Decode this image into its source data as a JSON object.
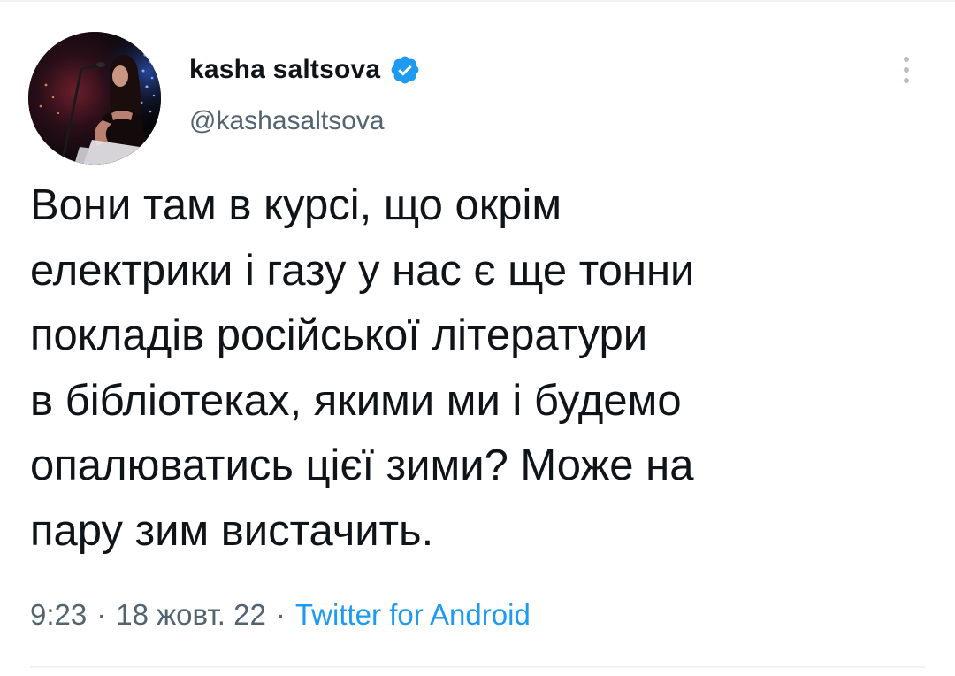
{
  "author": {
    "display_name": "kasha saltsova",
    "handle": "@kashasaltsova",
    "verified": true,
    "avatar_icon": "profile-photo",
    "verified_icon": "verified-badge-icon",
    "verified_color": "#1d9bf0"
  },
  "more_icon": "more-vertical-icon",
  "tweet": {
    "lines": [
      "Вони там в курсі, що окрім",
      "електрики і газу у нас є ще тонни",
      "покладів російської літератури",
      "в бібліотеках, якими ми і будемо",
      "опалюватись цієї зими? Може на",
      "пару зим вистачить."
    ]
  },
  "meta": {
    "time": "9:23",
    "separator": "·",
    "date": "18 жовт. 22",
    "source": "Twitter for Android"
  },
  "colors": {
    "text": "#0f1419",
    "secondary": "#536471",
    "accent": "#1d9bf0",
    "divider": "#eff3f4"
  }
}
